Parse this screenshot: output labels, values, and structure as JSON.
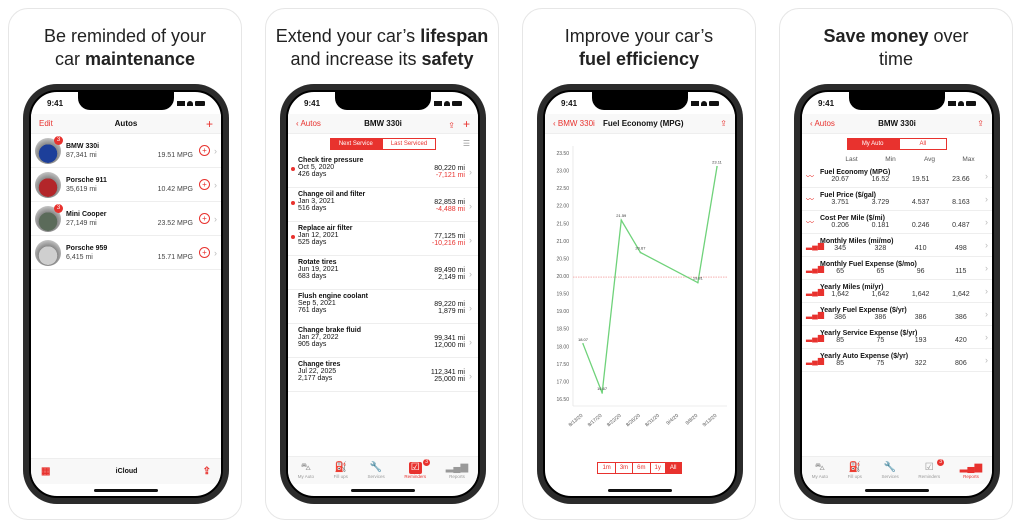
{
  "cards": [
    {
      "caption_plain_1": "Be reminded of your",
      "caption_plain_2": "car ",
      "caption_bold": "maintenance"
    },
    {
      "caption_plain_1": "Extend your car’s ",
      "caption_bold_1": "lifespan",
      "caption_plain_2": "and increase its ",
      "caption_bold_2": "safety"
    },
    {
      "caption_plain_1": "Improve your car’s",
      "caption_bold": "fuel efficiency"
    },
    {
      "caption_bold": "Save money",
      "caption_plain_1": " over",
      "caption_plain_2": "time"
    }
  ],
  "status_time": "9:41",
  "screen1": {
    "edit": "Edit",
    "title": "Autos",
    "add": "+",
    "autos": [
      {
        "name": "BMW 330i",
        "miles": "87,341 mi",
        "mpg": "19.51 MPG",
        "badge": "3",
        "color": "#1d3f9a"
      },
      {
        "name": "Porsche 911",
        "miles": "35,619 mi",
        "mpg": "10.42 MPG",
        "badge": "",
        "color": "#b3262a"
      },
      {
        "name": "Mini Cooper",
        "miles": "27,149 mi",
        "mpg": "23.52 MPG",
        "badge": "3",
        "color": "#5b6b5a"
      },
      {
        "name": "Porsche 959",
        "miles": "6,415 mi",
        "mpg": "15.71 MPG",
        "badge": "",
        "color": "#cfcfcf"
      }
    ],
    "bottom_label": "iCloud"
  },
  "screen2": {
    "back": "Autos",
    "title": "BMW 330i",
    "segments": [
      "Next Service",
      "Last Serviced"
    ],
    "services": [
      {
        "name": "Check tire pressure",
        "date": "Oct 5, 2020",
        "days": "426 days",
        "miles": "80,220 mi",
        "remaining": "-7,121 mi",
        "overdue": true
      },
      {
        "name": "Change oil and filter",
        "date": "Jan 3, 2021",
        "days": "516 days",
        "miles": "82,853 mi",
        "remaining": "-4,488 mi",
        "overdue": true
      },
      {
        "name": "Replace air filter",
        "date": "Jan 12, 2021",
        "days": "525 days",
        "miles": "77,125 mi",
        "remaining": "-10,216 mi",
        "overdue": true
      },
      {
        "name": "Rotate tires",
        "date": "Jun 19, 2021",
        "days": "683 days",
        "miles": "89,490 mi",
        "remaining": "2,149 mi",
        "overdue": false
      },
      {
        "name": "Flush engine coolant",
        "date": "Sep 5, 2021",
        "days": "761 days",
        "miles": "89,220 mi",
        "remaining": "1,879 mi",
        "overdue": false
      },
      {
        "name": "Change brake fluid",
        "date": "Jan 27, 2022",
        "days": "905 days",
        "miles": "99,341 mi",
        "remaining": "12,000 mi",
        "overdue": false
      },
      {
        "name": "Change tires",
        "date": "Jul 22, 2025",
        "days": "2,177 days",
        "miles": "112,341 mi",
        "remaining": "25,000 mi",
        "overdue": false
      }
    ]
  },
  "tabs": [
    {
      "label": "My Auto",
      "icon": "car-icon"
    },
    {
      "label": "Fill ups",
      "icon": "fuel-pump-icon"
    },
    {
      "label": "Services",
      "icon": "wrench-icon"
    },
    {
      "label": "Reminders",
      "icon": "reminder-icon",
      "badge": "3"
    },
    {
      "label": "Reports",
      "icon": "bar-chart-icon"
    }
  ],
  "screen3": {
    "back": "BMW 330i",
    "title": "Fuel Economy (MPG)",
    "ranges": [
      "1m",
      "3m",
      "6m",
      "1y",
      "All"
    ],
    "selected_range": "All"
  },
  "chart_data": {
    "type": "line",
    "title": "Fuel Economy (MPG)",
    "xlabel": "",
    "ylabel": "",
    "x": [
      "8/13/20",
      "8/17/20",
      "8/22/20",
      "8/26/20",
      "8/31/20",
      "9/4/20",
      "9/8/20",
      "9/13/20"
    ],
    "series": [
      {
        "name": "MPG",
        "points": [
          {
            "x": "8/13/20",
            "y": 18.07
          },
          {
            "x": "8/17/20",
            "y": 16.67
          },
          {
            "x": "8/22/20",
            "y": 21.59
          },
          {
            "x": "8/26/20",
            "y": 20.67
          },
          {
            "x": "9/8/20",
            "y": 19.81
          },
          {
            "x": "9/13/20",
            "y": 23.11
          }
        ],
        "color": "#6fd27a"
      }
    ],
    "reference_line": {
      "y": 19.97,
      "color": "#f08080"
    },
    "yticks": [
      16.5,
      17.0,
      17.5,
      18.0,
      18.5,
      19.0,
      19.5,
      20.0,
      20.5,
      21.0,
      21.5,
      22.0,
      22.5,
      23.0,
      23.5
    ],
    "ylim": [
      16.3,
      23.7
    ],
    "grid": false,
    "legend": "none"
  },
  "screen4": {
    "back": "Autos",
    "title": "BMW 330i",
    "segments": [
      "My Auto",
      "All"
    ],
    "columns": [
      "Last",
      "Min",
      "Avg",
      "Max"
    ],
    "reports": [
      {
        "title": "Fuel Economy (MPG)",
        "values": [
          "20.67",
          "16.52",
          "19.51",
          "23.66"
        ],
        "icon": "line-chart-icon"
      },
      {
        "title": "Fuel Price ($/gal)",
        "values": [
          "3.751",
          "3.729",
          "4.537",
          "8.163"
        ],
        "icon": "line-chart-icon"
      },
      {
        "title": "Cost Per Mile ($/mi)",
        "values": [
          "0.206",
          "0.181",
          "0.246",
          "0.487"
        ],
        "icon": "line-chart-icon"
      },
      {
        "title": "Monthly Miles (mi/mo)",
        "values": [
          "345",
          "328",
          "410",
          "498"
        ],
        "icon": "bar-chart-icon"
      },
      {
        "title": "Monthly Fuel Expense ($/mo)",
        "values": [
          "65",
          "65",
          "96",
          "115"
        ],
        "icon": "bar-chart-icon"
      },
      {
        "title": "Yearly Miles (mi/yr)",
        "values": [
          "1,642",
          "1,642",
          "1,642",
          "1,642"
        ],
        "icon": "bar-chart-icon"
      },
      {
        "title": "Yearly Fuel Expense ($/yr)",
        "values": [
          "386",
          "386",
          "386",
          "386"
        ],
        "icon": "bar-chart-icon"
      },
      {
        "title": "Yearly Service Expense ($/yr)",
        "values": [
          "85",
          "75",
          "193",
          "420"
        ],
        "icon": "bar-chart-icon"
      },
      {
        "title": "Yearly Auto Expense ($/yr)",
        "values": [
          "85",
          "75",
          "322",
          "806"
        ],
        "icon": "bar-chart-icon"
      }
    ]
  },
  "colors": {
    "accent": "#e8322e",
    "line": "#6fd27a"
  }
}
